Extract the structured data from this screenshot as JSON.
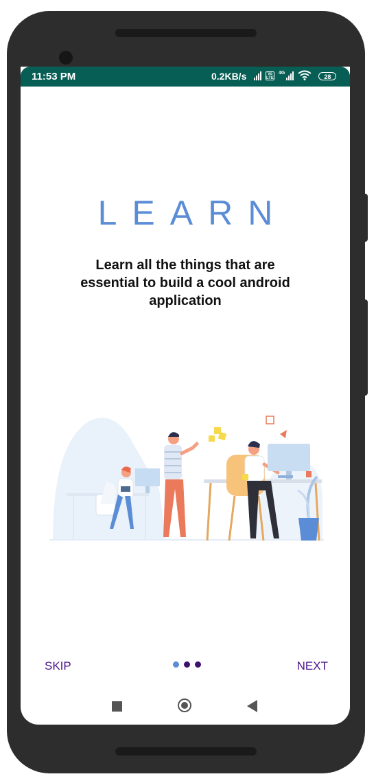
{
  "status_bar": {
    "time": "11:53 PM",
    "network_speed": "0.2KB/s",
    "volte_label": "Vo LTE",
    "network_type": "4G",
    "battery": "28",
    "icons": [
      "signal-icon",
      "volte-icon",
      "signal-4g-icon",
      "wifi-icon",
      "battery-icon"
    ]
  },
  "onboarding": {
    "title": "LEARN",
    "description": "Learn all the things that are essential to build a cool android application",
    "illustration": "team-working-illustration"
  },
  "footer": {
    "skip_label": "SKIP",
    "next_label": "NEXT",
    "page_count": 3,
    "current_page": 1
  },
  "nav_bar": {
    "icons": [
      "recents-square-icon",
      "home-circle-icon",
      "back-triangle-icon"
    ]
  },
  "colors": {
    "status_bar": "#075e54",
    "title": "#5b8dd6",
    "action_text": "#4a148c",
    "dot_active": "#5b8dd6",
    "dot_inactive": "#3d1170",
    "phone_body": "#2d2d2d"
  }
}
